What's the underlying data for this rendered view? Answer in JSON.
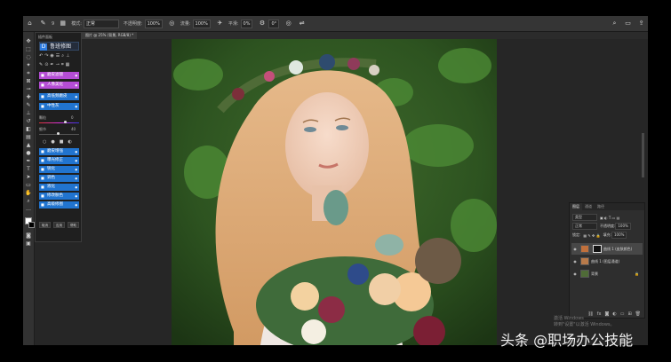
{
  "options_bar": {
    "home_icon": "home-icon",
    "brush_icon": "brush-icon",
    "size_value": "9",
    "mode_label": "模式:",
    "mode_value": "正常",
    "opacity_label": "不透明度:",
    "opacity_value": "100%",
    "flow_label": "流量:",
    "flow_value": "100%",
    "smooth_label": "平滑:",
    "smooth_value": "0%",
    "angle_value": "0°"
  },
  "document_tab": {
    "label": "图片 @ 25% (背景, RGB/8) *"
  },
  "plugin_panel": {
    "title": "插件面板",
    "logo_text": "鲁班修图",
    "buttons_top": [
      {
        "label": "磨皮滤镜",
        "color": "pink"
      },
      {
        "label": "人像美化",
        "color": "pink"
      },
      {
        "label": "高低频磨皮",
        "color": "blue"
      },
      {
        "label": "中性灰",
        "color": "blue"
      }
    ],
    "slider1_label": "颗粒",
    "slider1_value": "0",
    "slider2_label": "细节",
    "slider2_value": "40",
    "buttons_bottom": [
      {
        "label": "磨皮增强"
      },
      {
        "label": "曝光修正"
      },
      {
        "label": "锐化"
      },
      {
        "label": "调色"
      },
      {
        "label": "液化"
      },
      {
        "label": "修改肤色"
      },
      {
        "label": "高级修图"
      }
    ],
    "footer": [
      "取消",
      "应用",
      "帮助"
    ]
  },
  "layers_panel": {
    "tabs": [
      "图层",
      "通道",
      "路径"
    ],
    "kind_filter": "类型",
    "blend_mode": "正常",
    "opacity_label": "不透明度:",
    "opacity_value": "100%",
    "lock_label": "锁定:",
    "fill_label": "填充:",
    "fill_value": "100%",
    "layers": [
      {
        "name": "曲线 1 (皮肤颜色)",
        "selected": true
      },
      {
        "name": "曲线 1 (图层通道)",
        "selected": false
      },
      {
        "name": "背景",
        "selected": false
      }
    ]
  },
  "watermark": {
    "line1": "激活 Windows",
    "line2": "转到\"设置\"以激活 Windows。"
  },
  "credit": "头条 @职场办公技能"
}
